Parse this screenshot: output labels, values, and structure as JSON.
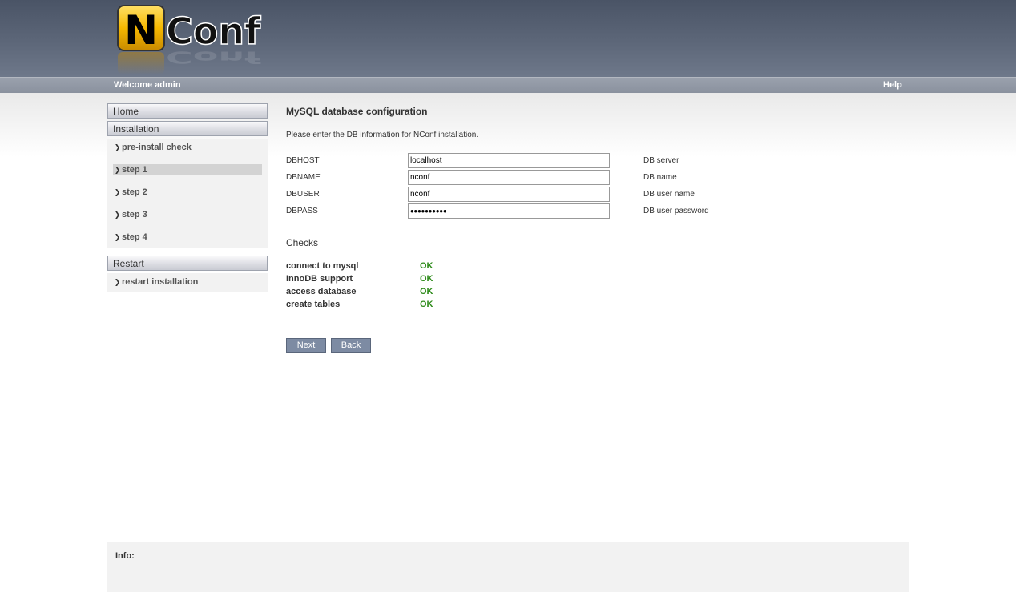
{
  "header": {
    "logo_text": "NConf",
    "welcome": "Welcome admin",
    "help": "Help"
  },
  "sidebar": {
    "home": "Home",
    "installation": "Installation",
    "installation_items": [
      {
        "label": "pre-install check"
      },
      {
        "label": "step 1",
        "active": true
      },
      {
        "label": "step 2"
      },
      {
        "label": "step 3"
      },
      {
        "label": "step 4"
      }
    ],
    "restart": "Restart",
    "restart_items": [
      {
        "label": "restart installation"
      }
    ]
  },
  "main": {
    "title": "MySQL database configuration",
    "intro": "Please enter the DB information for NConf installation.",
    "fields": [
      {
        "label": "DBHOST",
        "value": "localhost",
        "desc": "DB server"
      },
      {
        "label": "DBNAME",
        "value": "nconf",
        "desc": "DB name"
      },
      {
        "label": "DBUSER",
        "value": "nconf",
        "desc": "DB user name"
      },
      {
        "label": "DBPASS",
        "value": "••••••••••",
        "desc": "DB user password"
      }
    ],
    "checks_title": "Checks",
    "checks": [
      {
        "label": "connect to mysql",
        "status": "OK"
      },
      {
        "label": "InnoDB support",
        "status": "OK"
      },
      {
        "label": "access database",
        "status": "OK"
      },
      {
        "label": "create tables",
        "status": "OK"
      }
    ],
    "next": "Next",
    "back": "Back"
  },
  "info": {
    "label": "Info:"
  },
  "colors": {
    "ok": "#2e8b1a",
    "button": "#7d8ba3",
    "logo_yellow": "#f5b800"
  }
}
